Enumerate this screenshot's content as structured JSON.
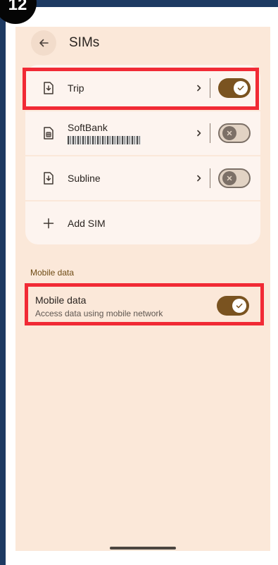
{
  "badge": {
    "number": "12"
  },
  "header": {
    "title": "SIMs"
  },
  "sims": [
    {
      "label": "Trip",
      "icon": "sim-card-download-icon",
      "enabled": true
    },
    {
      "label": "SoftBank",
      "icon": "sim-card-chip-icon",
      "enabled": false,
      "subtitle_obscured": true
    },
    {
      "label": "Subline",
      "icon": "sim-card-download-icon",
      "enabled": false
    }
  ],
  "add_sim": {
    "label": "Add SIM"
  },
  "mobile_data_section": {
    "header": "Mobile data",
    "item": {
      "title": "Mobile data",
      "description": "Access data using mobile network",
      "enabled": true
    }
  },
  "colors": {
    "frame": "#1d3a62",
    "screen_bg": "#fbe8d9",
    "card_bg": "#fdf4ef",
    "accent": "#7a5320",
    "section_header": "#6e4b14",
    "highlight": "#f12a35"
  }
}
